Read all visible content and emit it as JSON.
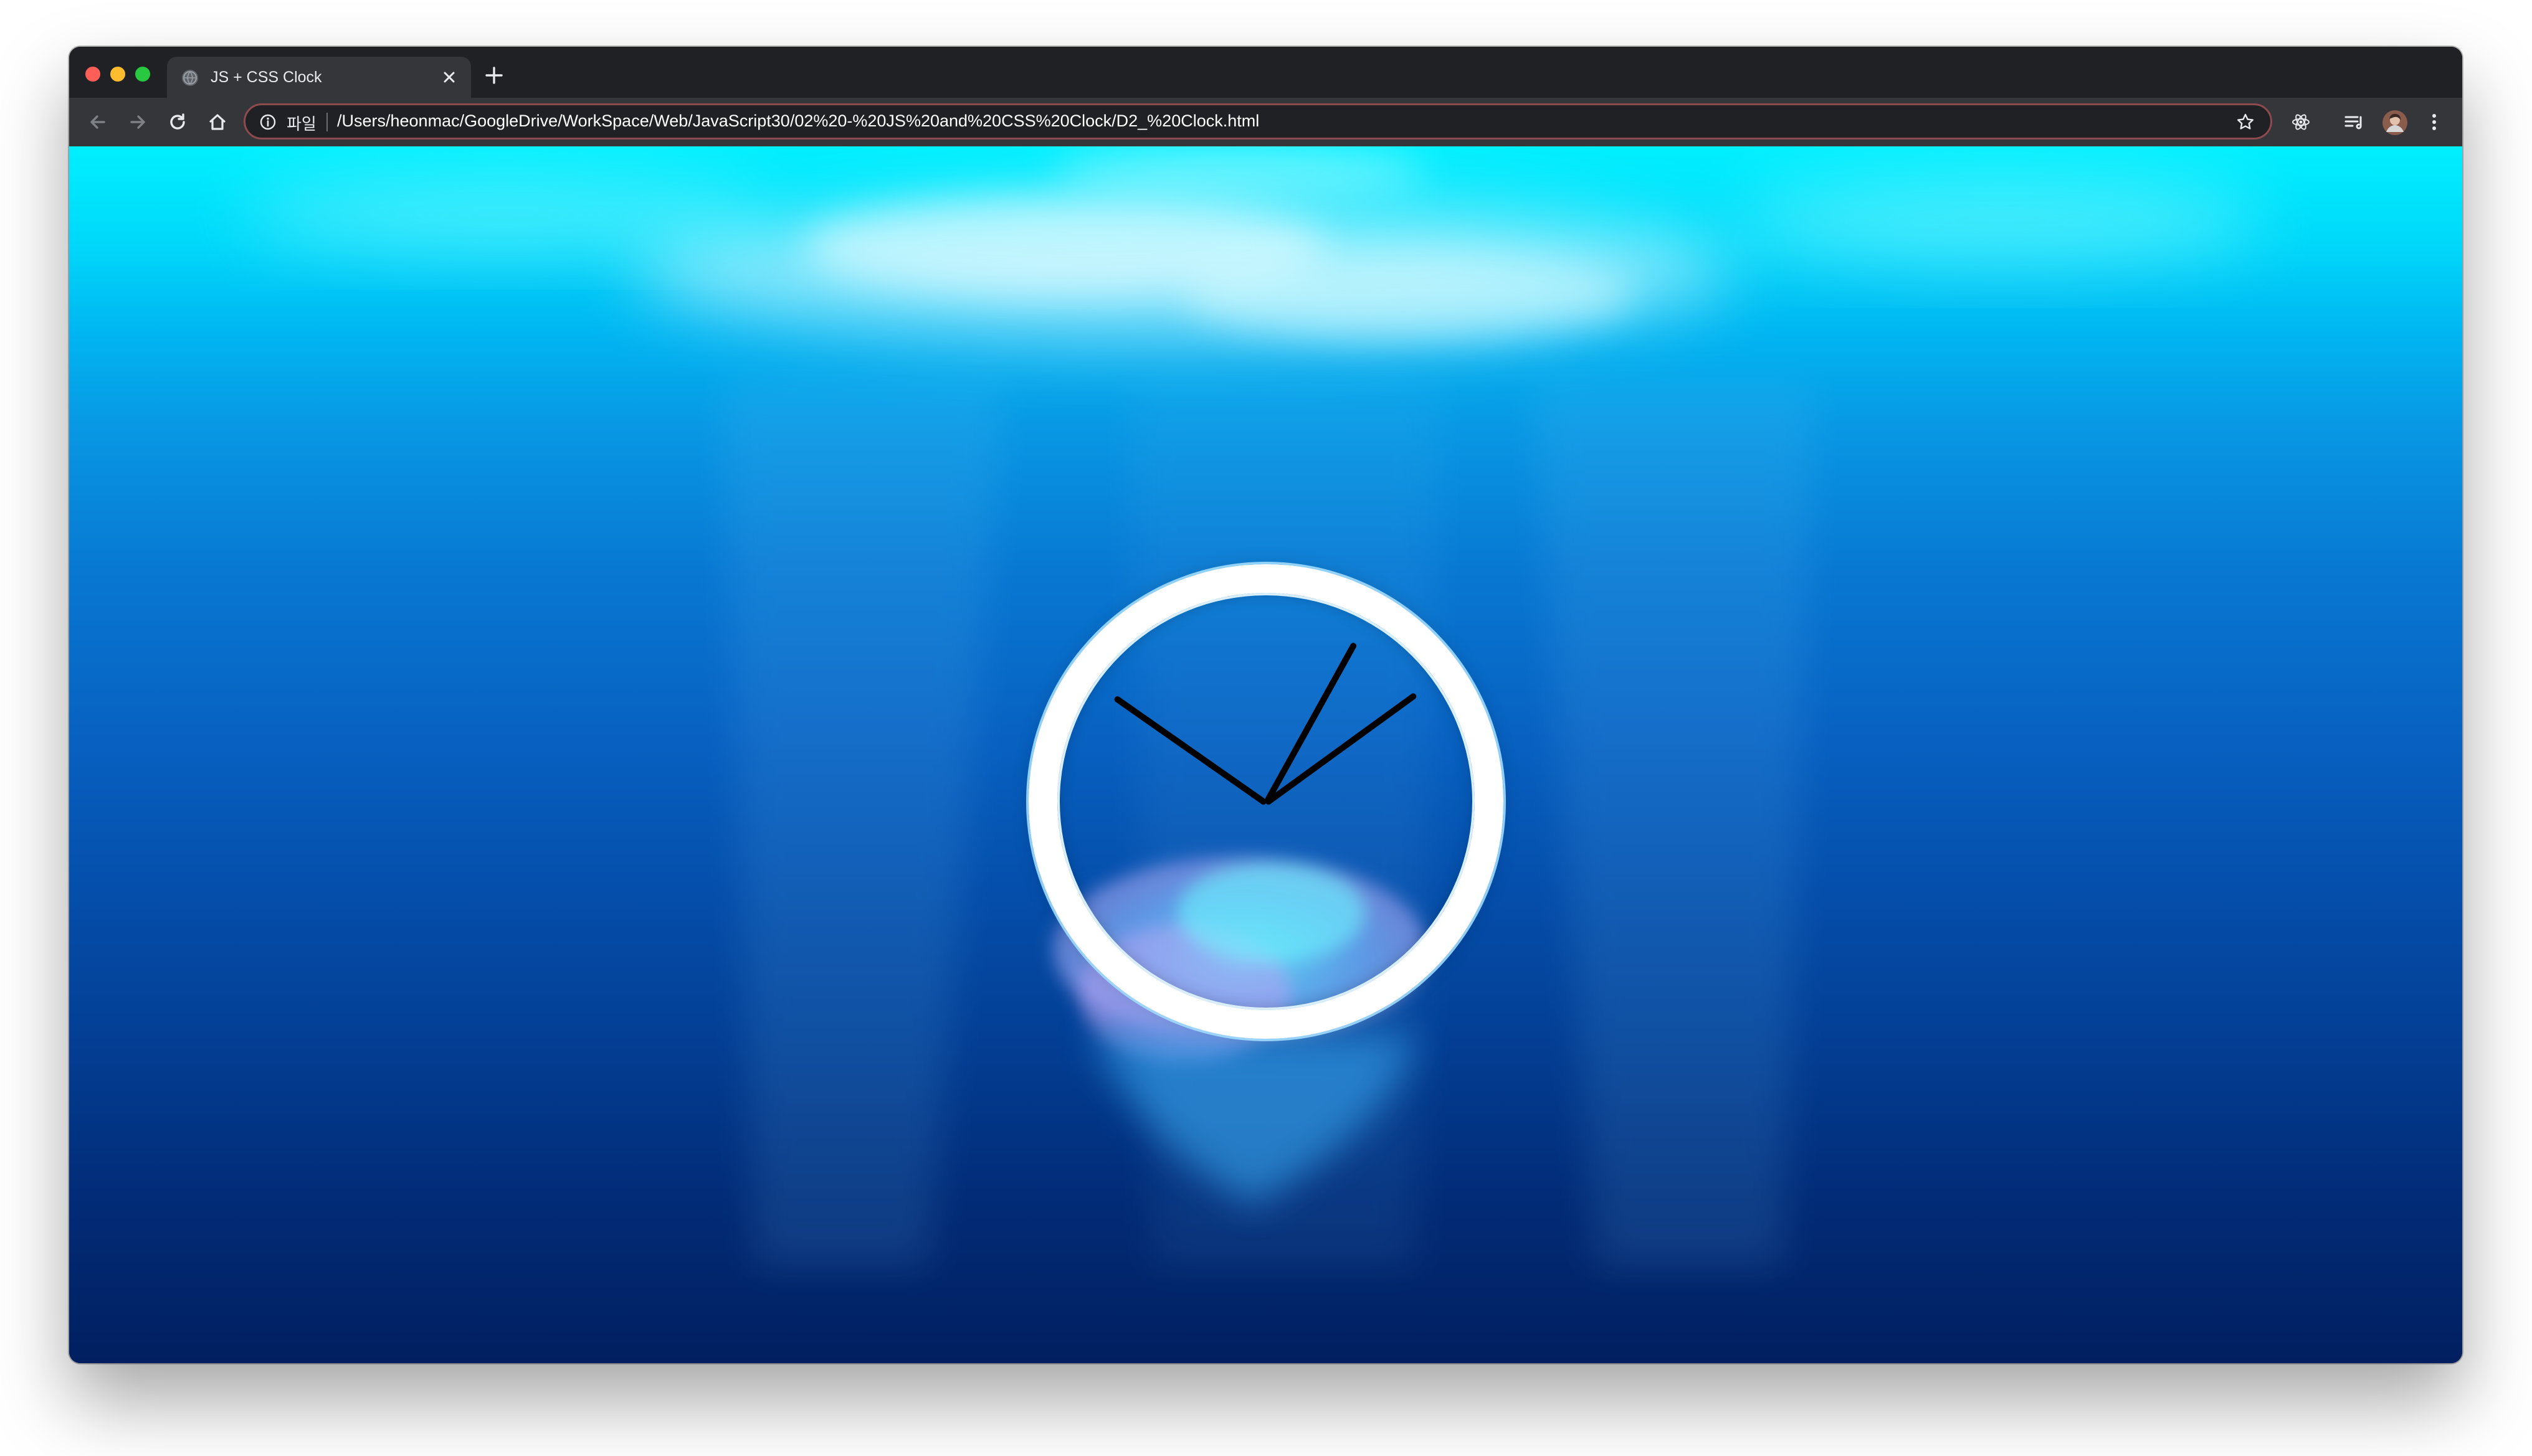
{
  "browser": {
    "tab": {
      "title": "JS + CSS Clock",
      "favicon": "globe-icon"
    },
    "omnibox": {
      "security_chip": "파일",
      "url": "/Users/heonmac/GoogleDrive/WorkSpace/Web/JavaScript30/02%20-%20JS%20and%20CSS%20Clock/D2_%20Clock.html"
    },
    "toolbar_icons": [
      "back-icon",
      "forward-icon",
      "reload-icon",
      "home-icon",
      "info-icon",
      "bookmark-star-icon",
      "react-devtools-icon",
      "reading-list-icon",
      "profile-avatar",
      "menu-dots-icon"
    ]
  },
  "page": {
    "background": "underwater-jellyfish",
    "clock": {
      "hour_angle_deg": 305,
      "minute_angle_deg": 29,
      "second_angle_deg": 54
    }
  },
  "colors": {
    "frame": "#202124",
    "toolbar": "#35363a",
    "omnibox_border": "#8d4a4f",
    "clock_ring": "#ffffff",
    "hands": "#000000"
  }
}
